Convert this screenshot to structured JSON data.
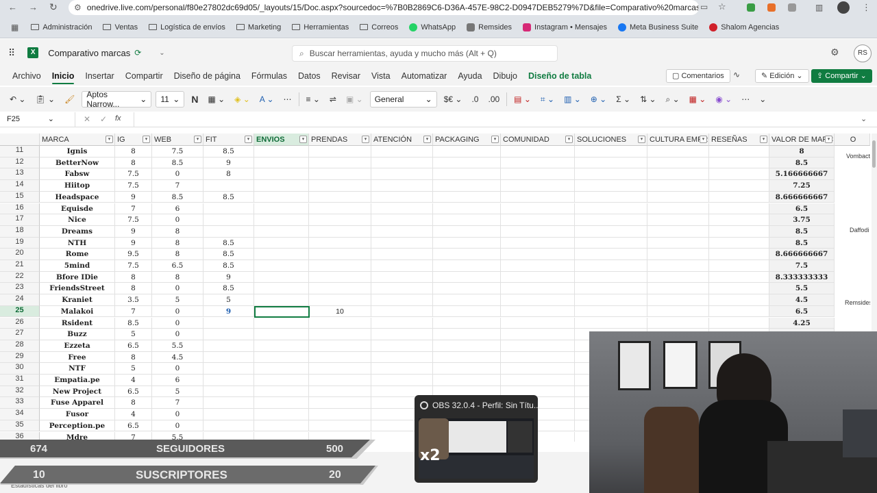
{
  "browser": {
    "url": "onedrive.live.com/personal/f80e27802dc69d05/_layouts/15/Doc.aspx?sourcedoc=%7B0B2869C6-D36A-457E-98C2-D0947DEB5279%7D&file=Comparativo%20marcas.xls...",
    "bookmarks": [
      "Administración",
      "Ventas",
      "Logística de envíos",
      "Marketing",
      "Herramientas",
      "Correos",
      "WhatsApp",
      "Remsides",
      "Instagram • Mensajes",
      "Meta Business Suite",
      "Shalom Agencias"
    ]
  },
  "app": {
    "doc_title": "Comparativo marcas",
    "search_placeholder": "Buscar herramientas, ayuda y mucho más (Alt + Q)",
    "avatar": "RS"
  },
  "menus": [
    "Archivo",
    "Inicio",
    "Insertar",
    "Compartir",
    "Diseño de página",
    "Fórmulas",
    "Datos",
    "Revisar",
    "Vista",
    "Automatizar",
    "Ayuda",
    "Dibujo",
    "Diseño de tabla"
  ],
  "menu_active": "Inicio",
  "menu_right": {
    "comments": "Comentarios",
    "edit": "Edición",
    "share": "Compartir"
  },
  "ribbon": {
    "font": "Aptos Narrow...",
    "size": "11",
    "bold": "N",
    "format": "General"
  },
  "formula": {
    "namebox": "F25",
    "fx": "fx",
    "content": ""
  },
  "columns": [
    "MARCA",
    "IG",
    "WEB",
    "FIT",
    "ENVIOS",
    "PRENDAS",
    "ATENCIÓN",
    "PACKAGING",
    "COMUNIDAD",
    "SOLUCIONES",
    "CULTURA EMPR",
    "RESEÑAS",
    "VALOR DE MARC",
    "O"
  ],
  "rows": [
    {
      "n": "11",
      "marca": "Ignis",
      "ig": "8",
      "web": "7.5",
      "fit": "8.5",
      "prendas": "",
      "valor": "8"
    },
    {
      "n": "12",
      "marca": "BetterNow",
      "ig": "8",
      "web": "8.5",
      "fit": "9",
      "prendas": "",
      "valor": "8.5"
    },
    {
      "n": "13",
      "marca": "Fabsw",
      "ig": "7.5",
      "web": "0",
      "fit": "8",
      "prendas": "",
      "valor": "5.166666667"
    },
    {
      "n": "14",
      "marca": "Hiitop",
      "ig": "7.5",
      "web": "7",
      "fit": "",
      "prendas": "",
      "valor": "7.25"
    },
    {
      "n": "15",
      "marca": "Headspace",
      "ig": "9",
      "web": "8.5",
      "fit": "8.5",
      "prendas": "",
      "valor": "8.666666667"
    },
    {
      "n": "16",
      "marca": "Equisde",
      "ig": "7",
      "web": "6",
      "fit": "",
      "prendas": "",
      "valor": "6.5"
    },
    {
      "n": "17",
      "marca": "Nice",
      "ig": "7.5",
      "web": "0",
      "fit": "",
      "prendas": "",
      "valor": "3.75"
    },
    {
      "n": "18",
      "marca": "Dreams",
      "ig": "9",
      "web": "8",
      "fit": "",
      "prendas": "",
      "valor": "8.5"
    },
    {
      "n": "19",
      "marca": "NTH",
      "ig": "9",
      "web": "8",
      "fit": "8.5",
      "prendas": "",
      "valor": "8.5"
    },
    {
      "n": "20",
      "marca": "Rome",
      "ig": "9.5",
      "web": "8",
      "fit": "8.5",
      "prendas": "",
      "valor": "8.666666667"
    },
    {
      "n": "21",
      "marca": "5mind",
      "ig": "7.5",
      "web": "6.5",
      "fit": "8.5",
      "prendas": "",
      "valor": "7.5"
    },
    {
      "n": "22",
      "marca": "Bfore IDie",
      "ig": "8",
      "web": "8",
      "fit": "9",
      "prendas": "",
      "valor": "8.333333333"
    },
    {
      "n": "23",
      "marca": "FriendsStreet",
      "ig": "8",
      "web": "0",
      "fit": "8.5",
      "prendas": "",
      "valor": "5.5"
    },
    {
      "n": "24",
      "marca": "Kraniet",
      "ig": "3.5",
      "web": "5",
      "fit": "5",
      "prendas": "",
      "valor": "4.5"
    },
    {
      "n": "25",
      "marca": "Malakoi",
      "ig": "7",
      "web": "0",
      "fit": "9",
      "prendas": "10",
      "valor": "6.5"
    },
    {
      "n": "26",
      "marca": "Rsident",
      "ig": "8.5",
      "web": "0",
      "fit": "",
      "prendas": "",
      "valor": "4.25"
    },
    {
      "n": "27",
      "marca": "Buzz",
      "ig": "5",
      "web": "0",
      "fit": "",
      "prendas": "",
      "valor": ""
    },
    {
      "n": "28",
      "marca": "Ezzeta",
      "ig": "6.5",
      "web": "5.5",
      "fit": "",
      "prendas": "",
      "valor": ""
    },
    {
      "n": "29",
      "marca": "Free",
      "ig": "8",
      "web": "4.5",
      "fit": "",
      "prendas": "",
      "valor": ""
    },
    {
      "n": "30",
      "marca": "NTF",
      "ig": "5",
      "web": "0",
      "fit": "",
      "prendas": "",
      "valor": ""
    },
    {
      "n": "31",
      "marca": "Empatia.pe",
      "ig": "4",
      "web": "6",
      "fit": "",
      "prendas": "",
      "valor": ""
    },
    {
      "n": "32",
      "marca": "New Project",
      "ig": "6.5",
      "web": "5",
      "fit": "",
      "prendas": "",
      "valor": ""
    },
    {
      "n": "33",
      "marca": "Fuse Apparel",
      "ig": "8",
      "web": "7",
      "fit": "",
      "prendas": "",
      "valor": ""
    },
    {
      "n": "34",
      "marca": "Fusor",
      "ig": "4",
      "web": "0",
      "fit": "",
      "prendas": "",
      "valor": ""
    },
    {
      "n": "35",
      "marca": "Perception.pe",
      "ig": "6.5",
      "web": "0",
      "fit": "",
      "prendas": "",
      "valor": ""
    },
    {
      "n": "36",
      "marca": "Mdre",
      "ig": "7",
      "web": "5.5",
      "fit": "",
      "prendas": "",
      "valor": ""
    }
  ],
  "side_labels": [
    "Vombact",
    "Daffodi",
    "Remsides"
  ],
  "status_text": "Estadísticas del libro",
  "overlay": {
    "row1": {
      "left": "674",
      "label": "SEGUIDORES",
      "right": "500"
    },
    "row2": {
      "left": "10",
      "label": "SUSCRIPTORES",
      "right": "20"
    },
    "obs_title": "OBS 32.0.4 - Perfil: Sin Títu...",
    "obs_badge": "x2"
  },
  "colors": {
    "accent": "#107c41",
    "selected_header": "#d9ecdf"
  }
}
